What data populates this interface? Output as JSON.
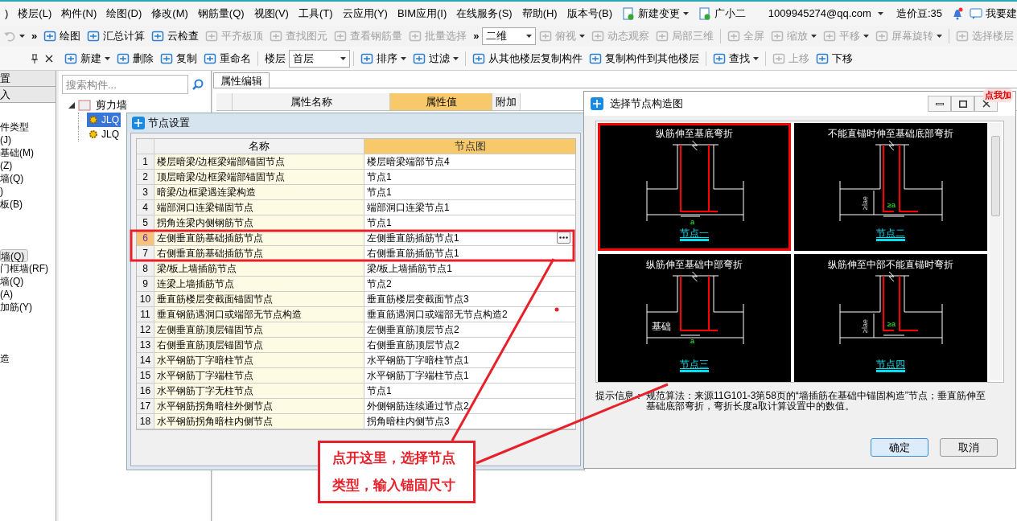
{
  "menu_bar": {
    "items": [
      ")",
      "楼层(L)",
      "构件(N)",
      "绘图(D)",
      "修改(M)",
      "钢筋量(Q)",
      "视图(V)",
      "工具(T)",
      "云应用(Y)",
      "BIM应用(I)",
      "在线服务(S)",
      "帮助(H)",
      "版本号(B)"
    ],
    "actions": [
      {
        "label": "新建变更",
        "dropdown": true
      },
      {
        "label": "广小二",
        "dropdown": false
      }
    ],
    "account": "1009945274@qq.com",
    "coins": "造价豆:35",
    "suggest": "我要建"
  },
  "toolbar_main": [
    {
      "kind": "icon",
      "disabled": true,
      "dropdown": true
    },
    {
      "kind": "overflow",
      "label": "»"
    },
    {
      "kind": "button",
      "label": "绘图",
      "disabled": false,
      "dropdown": false
    },
    {
      "kind": "button",
      "label": "汇总计算",
      "disabled": false,
      "dropdown": false
    },
    {
      "kind": "button",
      "label": "云检查",
      "disabled": false,
      "dropdown": false
    },
    {
      "kind": "button",
      "label": "平齐板顶",
      "disabled": true,
      "dropdown": false
    },
    {
      "kind": "button",
      "label": "查找图元",
      "disabled": true,
      "dropdown": false
    },
    {
      "kind": "button",
      "label": "查看钢筋量",
      "disabled": true,
      "dropdown": false
    },
    {
      "kind": "button",
      "label": "批量选择",
      "disabled": true,
      "dropdown": false
    },
    {
      "kind": "overflow",
      "label": "»"
    },
    {
      "kind": "select",
      "value": "二维"
    },
    {
      "kind": "button",
      "label": "俯视",
      "disabled": true,
      "dropdown": true
    },
    {
      "kind": "button",
      "label": "动态观察",
      "disabled": true,
      "dropdown": false
    },
    {
      "kind": "button",
      "label": "局部三维",
      "disabled": true,
      "dropdown": false
    },
    {
      "kind": "separator"
    },
    {
      "kind": "button",
      "label": "全屏",
      "disabled": true,
      "dropdown": false
    },
    {
      "kind": "button",
      "label": "缩放",
      "disabled": true,
      "dropdown": true
    },
    {
      "kind": "button",
      "label": "平移",
      "disabled": true,
      "dropdown": true
    },
    {
      "kind": "button",
      "label": "屏幕旋转",
      "disabled": true,
      "dropdown": true
    },
    {
      "kind": "separator"
    },
    {
      "kind": "button",
      "label": "选择楼层",
      "disabled": true,
      "dropdown": false
    }
  ],
  "toolbar_components": [
    {
      "kind": "button",
      "label": "新建",
      "disabled": false,
      "dropdown": true
    },
    {
      "kind": "button",
      "label": "删除",
      "disabled": false,
      "dropdown": false
    },
    {
      "kind": "button",
      "label": "复制",
      "disabled": false,
      "dropdown": false
    },
    {
      "kind": "button",
      "label": "重命名",
      "disabled": false,
      "dropdown": false
    },
    {
      "kind": "separator"
    },
    {
      "kind": "label",
      "label": "楼层"
    },
    {
      "kind": "select",
      "value": "首层"
    },
    {
      "kind": "separator"
    },
    {
      "kind": "button",
      "label": "排序",
      "disabled": false,
      "dropdown": true
    },
    {
      "kind": "button",
      "label": "过滤",
      "disabled": false,
      "dropdown": true
    },
    {
      "kind": "separator"
    },
    {
      "kind": "button",
      "label": "从其他楼层复制构件",
      "disabled": false,
      "dropdown": false
    },
    {
      "kind": "button",
      "label": "复制构件到其他楼层",
      "disabled": false,
      "dropdown": false
    },
    {
      "kind": "separator"
    },
    {
      "kind": "button",
      "label": "查找",
      "disabled": false,
      "dropdown": true
    },
    {
      "kind": "separator"
    },
    {
      "kind": "button",
      "label": "上移",
      "disabled": true,
      "dropdown": false
    },
    {
      "kind": "button",
      "label": "下移",
      "disabled": false,
      "dropdown": false
    }
  ],
  "left_panel": {
    "tabs": [
      "置",
      "入"
    ],
    "groups": [
      [
        {
          "label": "件类型",
          "selected": false
        },
        {
          "label": "(J)",
          "selected": false
        },
        {
          "label": "基础(M)",
          "selected": false
        },
        {
          "label": "(Z)",
          "selected": false
        },
        {
          "label": "墙(Q)",
          "selected": false
        },
        {
          "label": ")",
          "selected": false
        },
        {
          "label": "板(B)",
          "selected": false
        }
      ],
      [
        {
          "label": "墙(Q)",
          "selected": true
        },
        {
          "label": "门框墙(RF)",
          "selected": false
        },
        {
          "label": "墙(Q)",
          "selected": false
        },
        {
          "label": "(A)",
          "selected": false
        },
        {
          "label": "加筋(Y)",
          "selected": false
        }
      ],
      [
        {
          "label": "造",
          "selected": false
        }
      ]
    ]
  },
  "component_panel": {
    "search": {
      "placeholder": "搜索构件..."
    },
    "tree": [
      {
        "label": "剪力墙",
        "expanded": true,
        "selected": false,
        "children": [
          {
            "label": "JLQ",
            "selected": true
          },
          {
            "label": "JLQ",
            "selected": false
          }
        ]
      }
    ]
  },
  "property_panel": {
    "tab": "属性编辑",
    "columns": [
      {
        "label": "属性名称",
        "selected": false
      },
      {
        "label": "属性值",
        "selected": true
      },
      {
        "label": "附加",
        "selected": false
      }
    ]
  },
  "node_settings_dialog": {
    "title": "节点设置",
    "columns": [
      "名称",
      "节点图"
    ],
    "rows": [
      {
        "index": "1",
        "name": "楼层暗梁/边框梁端部锚固节点",
        "node": "楼层暗梁端部节点4",
        "selected": false
      },
      {
        "index": "2",
        "name": "顶层暗梁/边框梁端部锚固节点",
        "node": "节点1",
        "selected": false
      },
      {
        "index": "3",
        "name": "暗梁/边框梁遇连梁构造",
        "node": "节点1",
        "selected": false
      },
      {
        "index": "4",
        "name": "端部洞口连梁锚固节点",
        "node": "端部洞口连梁节点1",
        "selected": false
      },
      {
        "index": "5",
        "name": "拐角连梁内侧钢筋节点",
        "node": "节点1",
        "selected": false
      },
      {
        "index": "6",
        "name": "左侧垂直筋基础插筋节点",
        "node": "左侧垂直筋插筋节点1",
        "selected": true
      },
      {
        "index": "7",
        "name": "右侧垂直筋基础插筋节点",
        "node": "右侧垂直筋插筋节点1",
        "selected": false
      },
      {
        "index": "8",
        "name": "梁/板上墙插筋节点",
        "node": "梁/板上墙插筋节点1",
        "selected": false
      },
      {
        "index": "9",
        "name": "连梁上墙插筋节点",
        "node": "节点2",
        "selected": false
      },
      {
        "index": "10",
        "name": "垂直筋楼层变截面锚固节点",
        "node": "垂直筋楼层变截面节点3",
        "selected": false
      },
      {
        "index": "11",
        "name": "垂直钢筋遇洞口或端部无节点构造",
        "node": "垂直筋遇洞口或端部无节点构造2",
        "selected": false
      },
      {
        "index": "12",
        "name": "左侧垂直筋顶层锚固节点",
        "node": "左侧垂直筋顶层节点2",
        "selected": false
      },
      {
        "index": "13",
        "name": "右侧垂直筋顶层锚固节点",
        "node": "右侧垂直筋顶层节点2",
        "selected": false
      },
      {
        "index": "14",
        "name": "水平钢筋丁字暗柱节点",
        "node": "水平钢筋丁字暗柱节点1",
        "selected": false
      },
      {
        "index": "15",
        "name": "水平钢筋丁字端柱节点",
        "node": "水平钢筋丁字端柱节点1",
        "selected": false
      },
      {
        "index": "16",
        "name": "水平钢筋丁字无柱节点",
        "node": "节点1",
        "selected": false
      },
      {
        "index": "17",
        "name": "水平钢筋拐角暗柱外侧节点",
        "node": "外侧钢筋连续通过节点2",
        "selected": false
      },
      {
        "index": "18",
        "name": "水平钢筋拐角暗柱内侧节点",
        "node": "拐角暗柱内侧节点3",
        "selected": false
      }
    ]
  },
  "node_picture_dialog": {
    "title": "选择节点构造图",
    "options": [
      {
        "kind": "bottom",
        "title": "纵筋伸至基底弯折",
        "label": "节点一",
        "selected": true,
        "dim": "a"
      },
      {
        "kind": "bottom_lae",
        "title": "不能直锚时伸至基础底部弯折",
        "label": "节点二",
        "selected": false,
        "dim": "≥a",
        "lae": "≥lae"
      },
      {
        "kind": "middle",
        "title": "纵筋伸至基础中部弯折",
        "label": "节点三",
        "selected": false,
        "dim": "a",
        "base": "基础"
      },
      {
        "kind": "middle_lae",
        "title": "纵筋伸至中部不能直锚时弯折",
        "label": "节点四",
        "selected": false,
        "dim": "≥a",
        "lae": "≥lae"
      }
    ],
    "hint_label": "提示信息：",
    "hint": "规范算法：来源11G101-3第58页的“墙插筋在基础中锚固构造”节点；垂直筋伸至基础底部弯折，弯折长度a取计算设置中的数值。",
    "buttons": [
      "确定",
      "取消"
    ]
  },
  "promo_badge": "点我加",
  "annotation": {
    "text": "点开这里，选择节点类型，输入锚固尺寸"
  }
}
